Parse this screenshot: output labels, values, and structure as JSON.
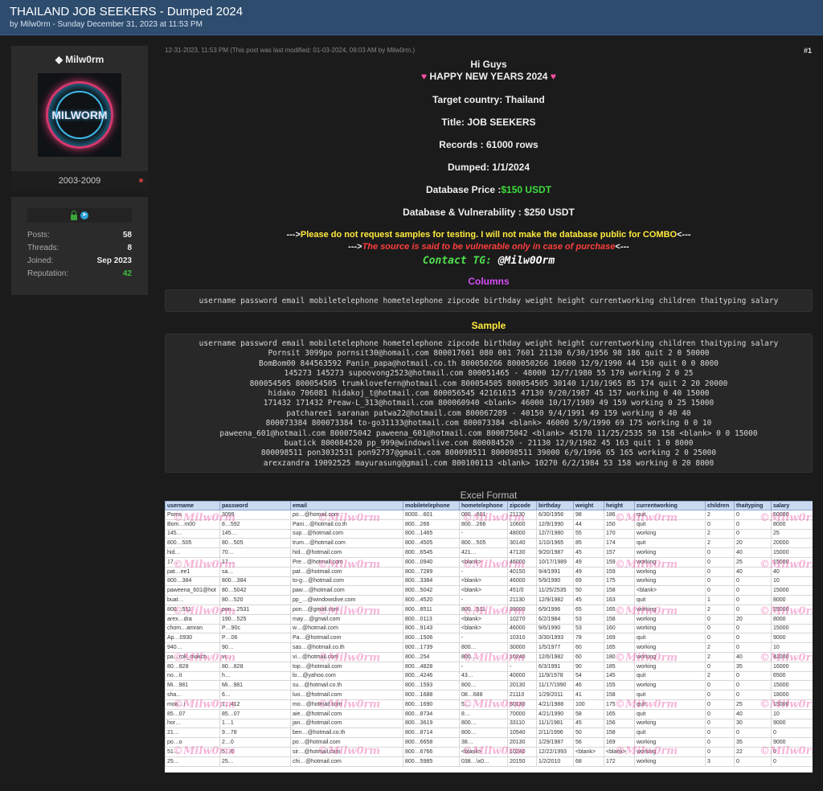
{
  "header": {
    "title": "THAILAND JOB SEEKERS - Dumped 2024",
    "subtitle": "by Milw0rm - Sunday December 31, 2023 at 11:53 PM"
  },
  "user": {
    "name": "Milw0rm",
    "avatar_text": "MILWORM",
    "years": "2003-2009",
    "stats": [
      {
        "label": "Posts:",
        "value": "58"
      },
      {
        "label": "Threads:",
        "value": "8"
      },
      {
        "label": "Joined:",
        "value": "Sep 2023"
      },
      {
        "label": "Reputation:",
        "value": "42"
      }
    ]
  },
  "post": {
    "meta": "12-31-2023, 11:53 PM  (This post was last modified: 01-03-2024, 09:03 AM by Milw0rm.)",
    "number": "#1",
    "greeting": "Hi Guys",
    "new_year": "HAPPY NEW YEARS 2024",
    "target_country": "Target country: Thailand",
    "title_line": "Title: JOB SEEKERS",
    "records": "Records : 61000 rows",
    "dumped": "Dumped: 1/1/2024",
    "db_price_label": "Database Price :",
    "db_price_value": "$150 USDT",
    "db_vuln": "Database & Vulnerability : $250 USDT",
    "notice_prefix": "--->",
    "notice_text": "Please do not request samples for testing. I will not make the database public for COMBO",
    "notice_suffix": "<---",
    "warning_prefix": "--->",
    "warning_text": "The source is said to be vulnerable only in case of purchase",
    "warning_suffix": "<---",
    "contact_label": "Contact TG:",
    "contact_handle": "@Milw0Orm",
    "columns_heading": "Columns",
    "columns_text": "username password email mobiletelephone hometelephone zipcode birthday weight height currentworking children thaityping salary",
    "sample_heading": "Sample",
    "sample_lines": [
      "username password email mobiletelephone hometelephone zipcode birthday weight height currentworking children thaityping salary",
      "Pornsit 3099po pornsit30@homail.com 800017601 080 001 7601 21130 6/30/1956 98 186 quit 2 0 50000",
      "BomBom00 844563592 Panin_papa@hotmail.co.th 800050266 800050266 10600 12/9/1990 44 150 quit 0 0 8000",
      "145273 145273 supoovong2523@hotmail.com 800051465 - 48000 12/7/1980 55 170 working 2 0 25",
      "800054505 800054505 trumklovefern@hotmail.com 800054505 800054505 30140 1/10/1965 85 174 quit 2 20 20000",
      "hidako 706081 hidakoj_t@hotmail.com 800056545 42161615 47130 9/20/1987 45 157 working 0 40 15000",
      "171432 171432 Preaw-L_313@hotmail.com 800060940 <blank> 46000 10/17/1989 49 159 working 0 25 15000",
      "patcharee1 saranan patwa22@hotmail.com 800067289 - 40150 9/4/1991 49 159 working 0 40 40",
      "800073384 800073384 to-go31133@hotmail.com 800073384 <blank> 46000 5/9/1990 69 175 working 0 0 10",
      "paweena_601@hotmail.com 800075042 paweena_601@hotmail.com 800075042 <blank> 45170 11/25/2535 50 158 <blank> 0 0 15000",
      "buatick 800084520 pp_999@windowslive.com 800084520 - 21130 12/9/1982 45 163 quit 1 0 8000",
      "800098511 pon3032531 pon92737@gmail.com 800098511 800098511 39000 6/9/1996 65 165 working 2 0 25000",
      "arexzandra 19092525 mayurasung@gmail.com 800100113 <blank> 10270 6/2/1984 53 158 working 0 20 8000"
    ],
    "excel_heading": "Excel Format",
    "watermark": "©Milw0rm"
  },
  "excel": {
    "headers": [
      "username",
      "password",
      "email",
      "mobiletelephone",
      "hometelephone",
      "zipcode",
      "birthday",
      "weight",
      "height",
      "currentworking",
      "children",
      "thaityping",
      "salary"
    ],
    "rows": [
      [
        "Porns",
        "3099",
        "po…@homail.com",
        "8000…601",
        "080…601",
        "21130",
        "6/30/1956",
        "98",
        "186",
        "quit",
        "2",
        "0",
        "50000"
      ],
      [
        "Bom…m00",
        "8…592",
        "Pani…@hotmail.co.th",
        "800…266",
        "800…266",
        "10600",
        "12/9/1990",
        "44",
        "150",
        "quit",
        "0",
        "0",
        "8000"
      ],
      [
        "145…",
        "145…",
        "sup…@hotmail.com",
        "800…1465",
        "-",
        "48000",
        "12/7/1980",
        "55",
        "170",
        "working",
        "2",
        "0",
        "25"
      ],
      [
        "800…505",
        "80…505",
        "trum…@hotmail.com",
        "800…4505",
        "800…505",
        "30140",
        "1/10/1965",
        "85",
        "174",
        "quit",
        "2",
        "20",
        "20000"
      ],
      [
        "hid…",
        "70…",
        "hid…@hotmail.com",
        "800…6545",
        "421…",
        "47130",
        "9/20/1987",
        "45",
        "157",
        "working",
        "0",
        "40",
        "15000"
      ],
      [
        "17…",
        "17…",
        "Pre…@hotmail.com",
        "800…0940",
        "<blank>",
        "46000",
        "10/17/1989",
        "49",
        "159",
        "working",
        "0",
        "25",
        "15000"
      ],
      [
        "pat…ee1",
        "sa…",
        "pat…@hotmail.com",
        "800…7289",
        "-",
        "40150",
        "9/4/1991",
        "49",
        "159",
        "working",
        "0",
        "40",
        "40"
      ],
      [
        "800…384",
        "800…384",
        "to-g…@hotmail.com",
        "800…3384",
        "<blank>",
        "46000",
        "5/9/1990",
        "69",
        "175",
        "working",
        "0",
        "0",
        "10"
      ],
      [
        "paweena_601@hot",
        "80…5042",
        "paw…@hotmail.com",
        "800…5042",
        "<blank>",
        "451/0",
        "11/25/2535",
        "50",
        "158",
        "<blank>",
        "0",
        "0",
        "15000"
      ],
      [
        "buat…",
        "80…520",
        "pp_…@windowslive.com",
        "800…4520",
        "-",
        "21130",
        "12/9/1982",
        "45",
        "163",
        "quit",
        "1",
        "0",
        "8000"
      ],
      [
        "800…511",
        "pon…2531",
        "pon…@gmail.com",
        "800…8511",
        "800…511",
        "39000",
        "6/9/1996",
        "65",
        "165",
        "working",
        "2",
        "0",
        "25000"
      ],
      [
        "arex…dra",
        "190…525",
        "may…@gmail.com",
        "800…0113",
        "<blank>",
        "10270",
        "6/2/1984",
        "53",
        "158",
        "working",
        "0",
        "20",
        "8000"
      ],
      [
        "chom…amran",
        "P…90c",
        "w…@hotmail.com",
        "800…9143",
        "<blank>",
        "46000",
        "9/6/1990",
        "53",
        "160",
        "working",
        "0",
        "0",
        "15000"
      ],
      [
        "Ap…0930",
        "P…06",
        "Pa…@hotmail.com",
        "800…1506",
        "-",
        "10310",
        "3/30/1993",
        "78",
        "169",
        "quit",
        "0",
        "0",
        "9000"
      ],
      [
        "940…",
        "90…",
        "sas…@hotmail.co.th",
        "800…1739",
        "800…",
        "30000",
        "1/5/1977",
        "60",
        "165",
        "working",
        "2",
        "0",
        "10"
      ],
      [
        "pa…rok_makch",
        "vi…",
        "vi…@hotmail.com",
        "800…254",
        "800…",
        "10240",
        "12/6/1982",
        "60",
        "180",
        "working",
        "2",
        "40",
        "42000"
      ],
      [
        "80…828",
        "80…828",
        "top…@hotmail.com",
        "800…4828",
        "-",
        "-",
        "6/3/1991",
        "90",
        "185",
        "working",
        "0",
        "35",
        "16000"
      ],
      [
        "no…it",
        "h…",
        "lo…@yahoo.com",
        "800…4246",
        "43…",
        "40000",
        "11/9/1978",
        "54",
        "145",
        "quit",
        "2",
        "0",
        "6500"
      ],
      [
        "Mi…981",
        "Mi…981",
        "su…@hotmail.co.th",
        "800…1593",
        "800…",
        "20130",
        "11/17/1990",
        "46",
        "155",
        "working",
        "0",
        "0",
        "15000"
      ],
      [
        "sha…",
        "6…",
        "luo…@hotmail.com",
        "800…1688",
        "08…688",
        "21110",
        "1/29/2011",
        "41",
        "158",
        "quit",
        "0",
        "0",
        "18000"
      ],
      [
        "moo…i",
        "1…412",
        "mo…@hotmail.com",
        "800…1690",
        "5…",
        "50130",
        "4/21/1988",
        "100",
        "175",
        "quit",
        "0",
        "25",
        "15000"
      ],
      [
        "85…07",
        "85…07",
        "aie…@hotmail.com",
        "800…8734",
        "8…",
        "70000",
        "4/21/1990",
        "58",
        "165",
        "quit",
        "0",
        "40",
        "10"
      ],
      [
        "hor…",
        "1…1",
        "jan…@hotmail.com",
        "800…3619",
        "800…",
        "33110",
        "11/1/1981",
        "45",
        "156",
        "working",
        "0",
        "30",
        "9000"
      ],
      [
        "21…",
        "9…78",
        "ben…@hotmail.co.th",
        "800…8714",
        "800…",
        "10540",
        "2/11/1996",
        "50",
        "158",
        "quit",
        "0",
        "0",
        "0"
      ],
      [
        "po…o",
        "2…0",
        "po…@hotmail.com",
        "800…6658",
        "38…",
        "20130",
        "1/29/1987",
        "56",
        "169",
        "working",
        "0",
        "35",
        "9000"
      ],
      [
        "51…",
        "5…6",
        "sir…@hotmail.com",
        "800…6766",
        "<blank>",
        "10240",
        "12/22/1993",
        "<blank>",
        "<blank>",
        "working",
        "0",
        "22",
        "0"
      ],
      [
        "25…",
        "25…",
        "chi…@hotmail.com",
        "800…5985",
        "038…\\x0…",
        "20150",
        "1/2/2010",
        "68",
        "172",
        "working",
        "3",
        "0",
        "0"
      ]
    ]
  }
}
